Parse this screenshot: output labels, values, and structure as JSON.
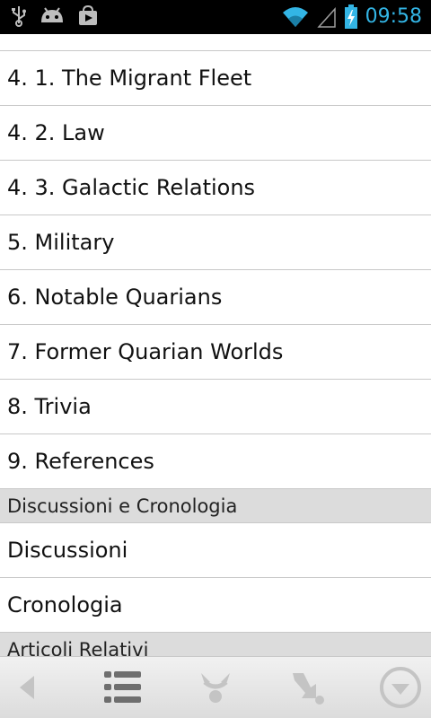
{
  "status_bar": {
    "time": "09:58",
    "icons": [
      "usb-icon",
      "android-icon",
      "store-icon",
      "wifi-icon",
      "signal-icon",
      "battery-charging-icon"
    ]
  },
  "list": {
    "items": [
      "4. 1. The Migrant Fleet",
      "4. 2. Law",
      "4. 3. Galactic Relations",
      "5. Military",
      "6. Notable Quarians",
      "7. Former Quarian Worlds",
      "8. Trivia",
      "9. References"
    ],
    "section_discussion": "Discussioni e Cronologia",
    "discussion_items": [
      "Discussioni",
      "Cronologia"
    ],
    "section_related": "Articoli Relativi"
  },
  "toolbar": {
    "icons": [
      "back-icon",
      "contents-list-icon",
      "share-icon",
      "save-icon",
      "menu-icon"
    ]
  }
}
